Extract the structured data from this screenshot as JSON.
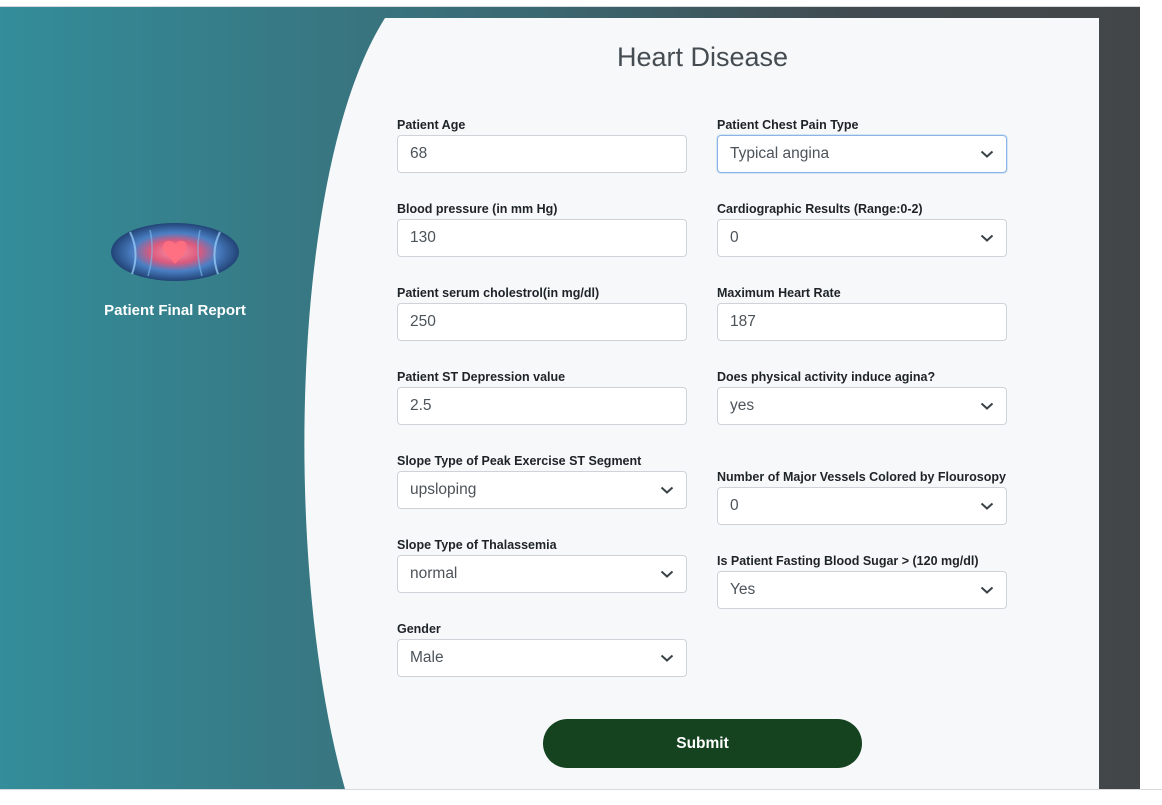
{
  "sidebar": {
    "title": "Patient Final Report",
    "image": "heart-anatomy-image"
  },
  "form": {
    "title": "Heart Disease",
    "fields": {
      "age": {
        "label": "Patient Age",
        "value": "68"
      },
      "chest_pain": {
        "label": "Patient Chest Pain Type",
        "value": "Typical angina"
      },
      "blood_pressure": {
        "label": "Blood pressure (in mm Hg)",
        "value": "130"
      },
      "cardio_results": {
        "label": "Cardiographic Results (Range:0-2)",
        "value": "0"
      },
      "cholesterol": {
        "label": "Patient serum cholestrol(in mg/dl)",
        "value": "250"
      },
      "max_heart_rate": {
        "label": "Maximum Heart Rate",
        "value": "187"
      },
      "st_depression": {
        "label": "Patient ST Depression value",
        "value": "2.5"
      },
      "exercise_angina": {
        "label": "Does physical activity induce agina?",
        "value": "yes"
      },
      "slope": {
        "label": "Slope Type of Peak Exercise ST Segment",
        "value": "upsloping"
      },
      "vessels": {
        "label": "Number of Major Vessels Colored by Flourosopy",
        "value": "0"
      },
      "thalassemia": {
        "label": "Slope Type of Thalassemia",
        "value": "normal"
      },
      "fasting_sugar": {
        "label": "Is Patient Fasting Blood Sugar > (120 mg/dl)",
        "value": "Yes"
      },
      "gender": {
        "label": "Gender",
        "value": "Male"
      }
    },
    "submit_label": "Submit"
  },
  "colors": {
    "gradient_start": "#338d9a",
    "gradient_end": "#424648",
    "card_bg": "#f6f8fa",
    "submit_bg": "#15421f"
  }
}
